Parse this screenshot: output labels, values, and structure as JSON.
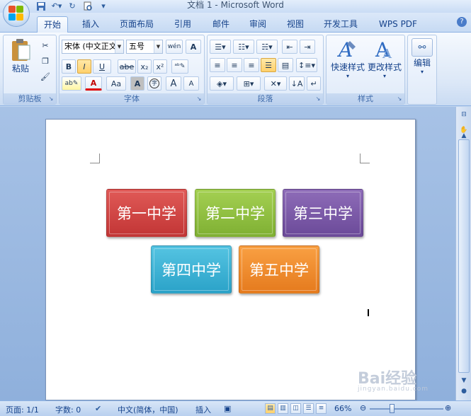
{
  "window": {
    "title": "文档 1 - Microsoft Word"
  },
  "tabs": [
    {
      "label": "开始",
      "active": true
    },
    {
      "label": "插入"
    },
    {
      "label": "页面布局"
    },
    {
      "label": "引用"
    },
    {
      "label": "邮件"
    },
    {
      "label": "审阅"
    },
    {
      "label": "视图"
    },
    {
      "label": "开发工具"
    },
    {
      "label": "WPS PDF"
    }
  ],
  "ribbon": {
    "clipboard": {
      "label": "剪贴板",
      "paste_label": "粘贴"
    },
    "font": {
      "label": "字体",
      "font_name": "宋体 (中文正文)",
      "font_size": "五号",
      "bold": "B",
      "italic": "I",
      "underline": "U",
      "strike": "abe",
      "sub": "x₂",
      "sup": "x²",
      "font_color": "A",
      "change_case": "Aa",
      "char_shade": "A",
      "enclose": "字",
      "grow": "A",
      "shrink": "A"
    },
    "paragraph": {
      "label": "段落"
    },
    "styles": {
      "label": "样式",
      "quick_styles": "快速样式",
      "change_styles": "更改样式"
    },
    "editing": {
      "label": "编辑"
    }
  },
  "document": {
    "smartart": [
      {
        "text": "第一中学",
        "color": "#d2403f"
      },
      {
        "text": "第二中学",
        "color": "#8fc040"
      },
      {
        "text": "第三中学",
        "color": "#7b57a7"
      },
      {
        "text": "第四中学",
        "color": "#3fb4d6"
      },
      {
        "text": "第五中学",
        "color": "#f38a2c"
      }
    ]
  },
  "statusbar": {
    "page": "页面: 1/1",
    "words": "字数: 0",
    "language": "中文(简体，中国)",
    "mode": "插入",
    "zoom": "66%"
  },
  "watermark": {
    "text": "Bai经验",
    "sub": "jingyan.baidu.com"
  },
  "colors": {
    "accent": "#15428b",
    "ribbon_bg": "#dbe7f7"
  }
}
